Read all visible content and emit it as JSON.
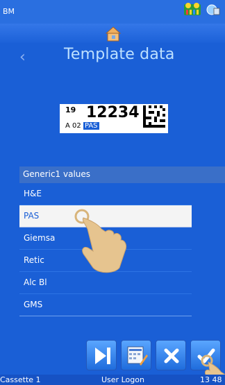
{
  "status_bar": {
    "title": "BM",
    "printer_icon": "printer-status-icon",
    "net_icon": "network-status-icon"
  },
  "nav": {
    "home_icon": "home-icon",
    "back_icon": "chevron-left-icon"
  },
  "page": {
    "title": "Template data"
  },
  "label_preview": {
    "small_number": "19",
    "big_number": "12234",
    "row_left": "A  02",
    "row_highlight": "PAS"
  },
  "list": {
    "header": "Generic1 values",
    "items": [
      {
        "label": "H&E",
        "selected": false
      },
      {
        "label": "PAS",
        "selected": true
      },
      {
        "label": "Giemsa",
        "selected": false
      },
      {
        "label": "Retic",
        "selected": false
      },
      {
        "label": "Alc Bl",
        "selected": false
      },
      {
        "label": "GMS",
        "selected": false
      }
    ]
  },
  "toolbar": {
    "buttons": [
      {
        "name": "next-button",
        "icon": "skip-next-icon"
      },
      {
        "name": "edit-template-button",
        "icon": "edit-template-icon"
      },
      {
        "name": "cancel-button",
        "icon": "close-icon"
      },
      {
        "name": "confirm-button",
        "icon": "check-icon"
      }
    ]
  },
  "footer": {
    "left": "Cassette 1",
    "middle": "User Logon",
    "right": "13 48"
  },
  "colors": {
    "background": "#1a5fd6",
    "title": "#bde0ff",
    "selected_row": "#f4f4f4"
  }
}
